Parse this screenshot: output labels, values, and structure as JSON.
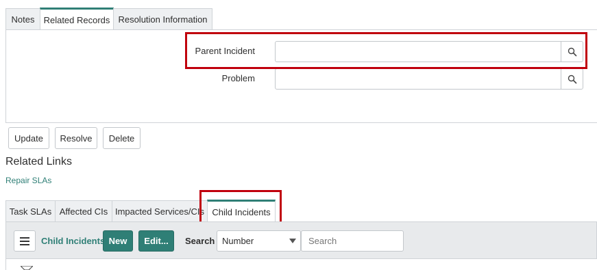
{
  "form_tabs": [
    {
      "label": "Notes"
    },
    {
      "label": "Related Records"
    },
    {
      "label": "Resolution Information"
    }
  ],
  "fields": {
    "parent_incident": {
      "label": "Parent Incident",
      "value": ""
    },
    "problem": {
      "label": "Problem",
      "value": ""
    }
  },
  "actions": {
    "update": "Update",
    "resolve": "Resolve",
    "delete": "Delete"
  },
  "related_links": {
    "heading": "Related Links",
    "items": [
      "Repair SLAs"
    ]
  },
  "related_tabs": [
    {
      "label": "Task SLAs"
    },
    {
      "label": "Affected CIs"
    },
    {
      "label": "Impacted Services/CIs"
    },
    {
      "label": "Child Incidents"
    }
  ],
  "list_toolbar": {
    "title": "Child Incidents",
    "new_label": "New",
    "edit_label": "Edit...",
    "search_label": "Search",
    "search_field_selected": "Number",
    "search_placeholder": "Search"
  },
  "colors": {
    "accent": "#2f7f76",
    "highlight": "#c0000c"
  }
}
